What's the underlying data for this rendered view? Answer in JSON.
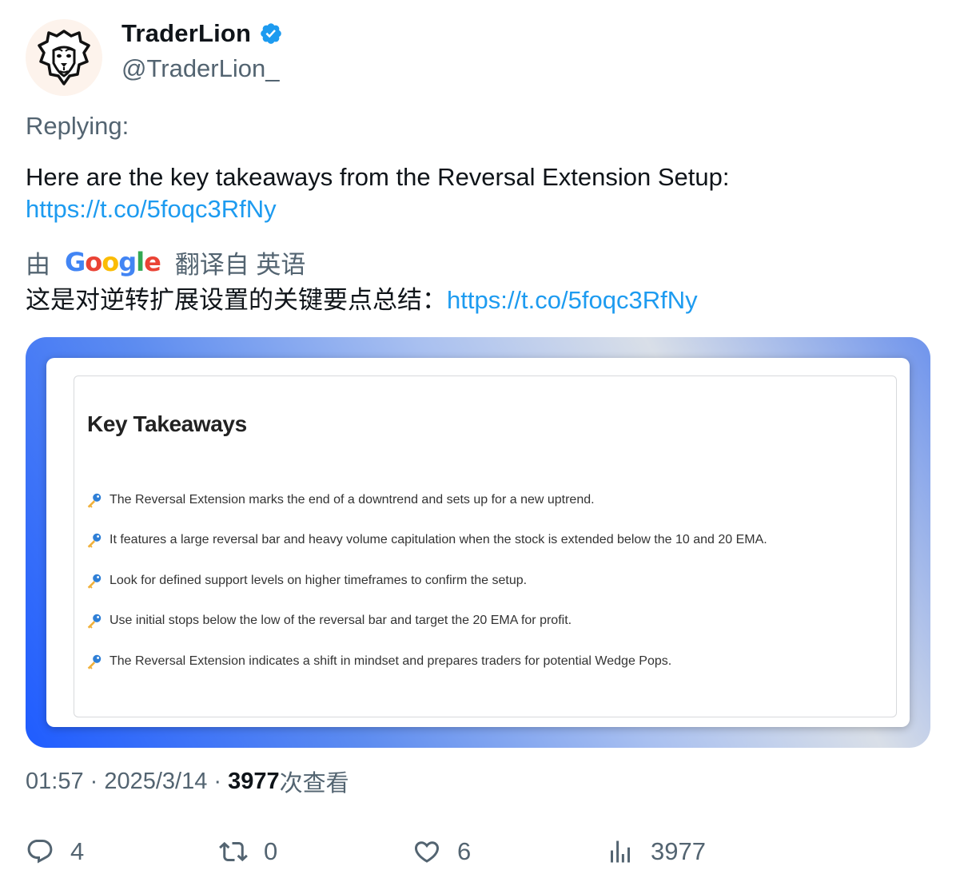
{
  "author": {
    "display_name": "TraderLion",
    "handle": "@TraderLion_",
    "verified": true,
    "avatar_icon": "lion-avatar-icon"
  },
  "tweet": {
    "replying_label": "Replying:",
    "text": "Here are the key takeaways from the Reversal Extension Setup:",
    "link": "https://t.co/5foqc3RfNy"
  },
  "translation": {
    "prefix": "由",
    "provider": "Google",
    "suffix": "翻译自 英语",
    "text": "这是对逆转扩展设置的关键要点总结：",
    "link": "https://t.co/5foqc3RfNy"
  },
  "media": {
    "title": "Key Takeaways",
    "items": [
      "The Reversal Extension marks the end of a downtrend and sets up for a new uptrend.",
      "It features a large reversal bar and heavy volume capitulation when the stock is extended below the 10 and 20 EMA.",
      "Look for defined support levels on higher timeframes to confirm the setup.",
      "Use initial stops below the low of the reversal bar and target the 20 EMA for profit.",
      "The Reversal Extension indicates a shift in mindset and prepares traders for potential Wedge Pops."
    ],
    "bullet_icon": "key-icon"
  },
  "meta": {
    "time": "01:57",
    "separator": " · ",
    "date": "2025/3/14",
    "views_count": "3977",
    "views_label": "次查看"
  },
  "actions": {
    "replies": "4",
    "retweets": "0",
    "likes": "6",
    "views": "3977"
  },
  "colors": {
    "link": "#1d9bf0",
    "verified": "#1d9bf0",
    "secondary_text": "#536471"
  }
}
